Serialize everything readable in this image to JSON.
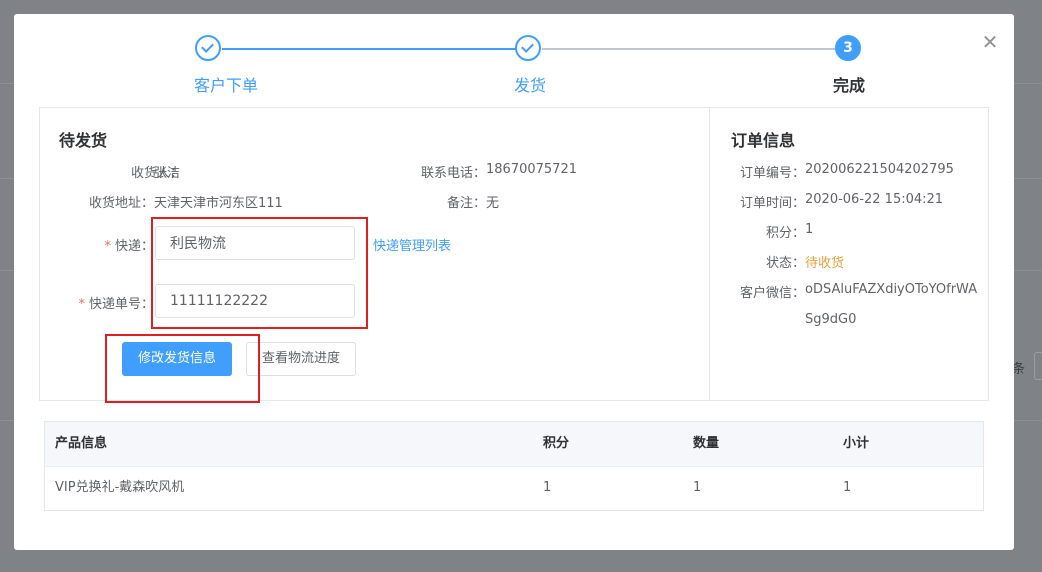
{
  "background": {
    "partial_text": "条"
  },
  "steps": [
    {
      "title": "客户下单",
      "status": "done"
    },
    {
      "title": "发货",
      "status": "done"
    },
    {
      "title": "完成",
      "status": "current",
      "number": "3"
    }
  ],
  "shipping": {
    "title": "待发货",
    "receiver_label": "收货人：",
    "receiver": "张洁",
    "phone_label": "联系电话：",
    "phone": "18670075721",
    "address_label": "收货地址：",
    "address": "天津天津市河东区111",
    "remark_label": "备注：",
    "remark": "无",
    "courier_label": "快递：",
    "courier_value": "利民物流",
    "courier_link": "快递管理列表",
    "tracking_label": "快递单号：",
    "tracking_value": "11111122222",
    "modify_button": "修改发货信息",
    "view_logistics_button": "查看物流进度"
  },
  "order": {
    "title": "订单信息",
    "number_label": "订单编号：",
    "number": "202006221504202795",
    "time_label": "订单时间：",
    "time": "2020-06-22 15:04:21",
    "points_label": "积分：",
    "points": "1",
    "status_label": "状态：",
    "status": "待收货",
    "status_color": "#e6a23c",
    "wechat_label": "客户微信：",
    "wechat_line1": "oDSAluFAZXdiyOToYOfrWA",
    "wechat_line2": "Sg9dG0"
  },
  "table": {
    "headers": [
      "产品信息",
      "积分",
      "数量",
      "小计"
    ],
    "rows": [
      [
        "VIP兑换礼-戴森吹风机",
        "1",
        "1",
        "1"
      ]
    ]
  },
  "colors": {
    "primary": "#409eff",
    "highlight": "#e02020"
  }
}
